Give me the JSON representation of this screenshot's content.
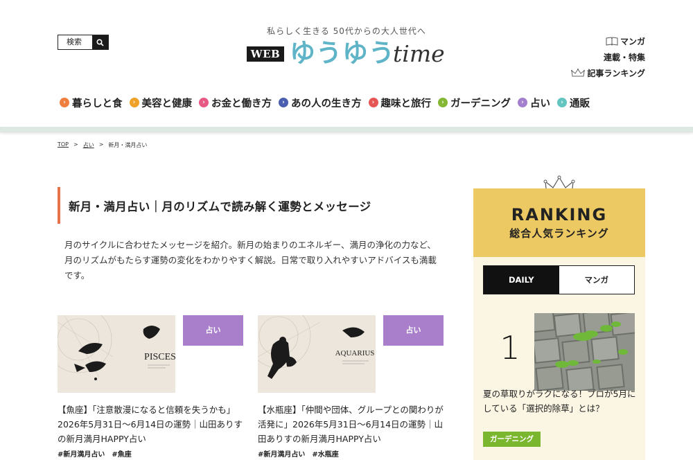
{
  "header": {
    "search_label": "検索",
    "tagline": "私らしく生きる 50代からの大人世代へ",
    "logo_web": "WEB",
    "logo_main": "ゆうゆう",
    "logo_script": "time",
    "utility": [
      {
        "label": "マンガ",
        "icon": "book-icon"
      },
      {
        "label": "連載・特集",
        "icon": ""
      },
      {
        "label": "記事ランキング",
        "icon": "crown-icon"
      }
    ]
  },
  "nav": [
    {
      "label": "暮らしと食",
      "color": "#ef7d3c"
    },
    {
      "label": "美容と健康",
      "color": "#efa128"
    },
    {
      "label": "お金と働き方",
      "color": "#e85a86"
    },
    {
      "label": "あの人の生き方",
      "color": "#4a5fb0"
    },
    {
      "label": "趣味と旅行",
      "color": "#e65655"
    },
    {
      "label": "ガーデニング",
      "color": "#84b734"
    },
    {
      "label": "占い",
      "color": "#a47fcd"
    },
    {
      "label": "通販",
      "color": "#63c5c0"
    }
  ],
  "breadcrumb": [
    "TOP",
    "占い",
    "新月・満月占い"
  ],
  "breadcrumb_sep": ">",
  "page": {
    "title": "新月・満月占い｜月のリズムで読み解く運勢とメッセージ",
    "lead": "月のサイクルに合わせたメッセージを紹介。新月の始まりのエネルギー、満月の浄化の力など、月のリズムがもたらす運勢の変化をわかりやすく解説。日常で取り入れやすいアドバイスも満載です。"
  },
  "articles": [
    {
      "tag": "占い",
      "image_label": "PISCES",
      "title": "【魚座】「注意散漫になると信頼を失うかも」2026年5月31日〜6月14日の運勢｜山田ありすの新月満月HAPPY占い",
      "hashtags": [
        "#新月満月占い",
        "#魚座"
      ]
    },
    {
      "tag": "占い",
      "image_label": "AQUARIUS",
      "title": "【水瓶座】「仲間や団体、グループとの関わりが活発に」2026年5月31日〜6月14日の運勢｜山田ありすの新月満月HAPPY占い",
      "hashtags": [
        "#新月満月占い",
        "#水瓶座"
      ]
    }
  ],
  "ranking": {
    "heading_en": "RANKING",
    "heading_ja": "総合人気ランキング",
    "tabs": [
      "DAILY",
      "マンガ"
    ],
    "active_tab": "DAILY",
    "items": [
      {
        "rank": "1",
        "title": "夏の草取りがラクになる！プロが5月にしている「選択的除草」とは？",
        "category": "ガーデニング"
      }
    ]
  },
  "colors": {
    "accent_orange": "#e8734b",
    "ranking_yellow": "#ecc962",
    "ranking_bg": "#fbf5e3",
    "uranai_purple": "#a97fcb",
    "gardening_green": "#7bb62f",
    "logo_teal": "#5fb5c7"
  }
}
